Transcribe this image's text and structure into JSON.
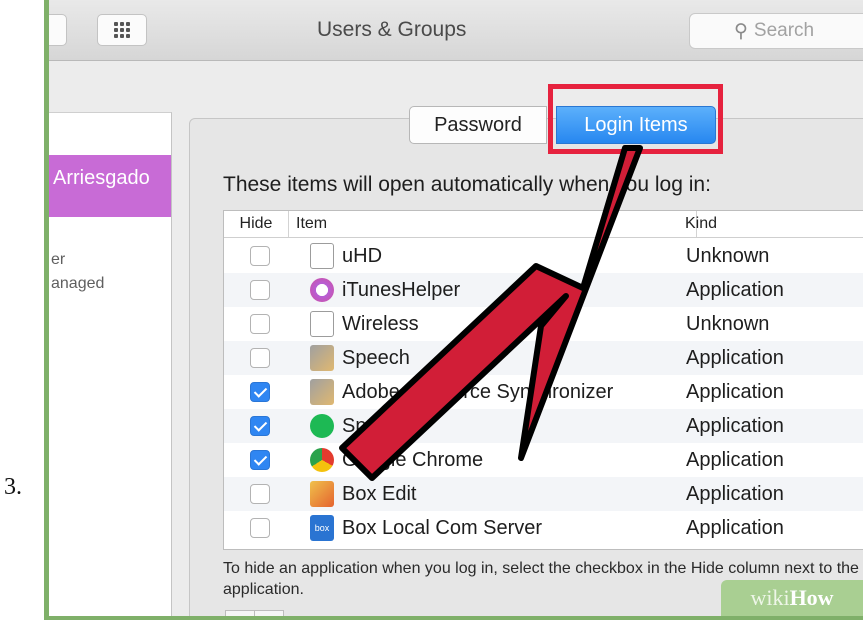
{
  "step_label": "3.",
  "window": {
    "title": "Users & Groups",
    "search_placeholder": "Search"
  },
  "users": {
    "selected": "Arriesgado",
    "line1": "er",
    "line2": "anaged"
  },
  "tabs": {
    "password": "Password",
    "login_items": "Login Items"
  },
  "login_items": {
    "heading": "These items will open automatically when you log in:",
    "columns": {
      "hide": "Hide",
      "item": "Item",
      "kind": "Kind"
    },
    "rows": [
      {
        "hide": false,
        "name": "uHD",
        "kind": "Unknown",
        "icon": "document-icon"
      },
      {
        "hide": false,
        "name": "iTunesHelper",
        "kind": "Application",
        "icon": "itunes-icon"
      },
      {
        "hide": false,
        "name": "Wireless",
        "kind": "Unknown",
        "icon": "document-icon"
      },
      {
        "hide": false,
        "name": "Speech",
        "kind": "Application",
        "icon": "utility-icon"
      },
      {
        "hide": true,
        "name": "Adobe Resource Synchronizer",
        "kind": "Application",
        "icon": "utility-icon"
      },
      {
        "hide": true,
        "name": "Spotify",
        "kind": "Application",
        "icon": "spotify-icon"
      },
      {
        "hide": true,
        "name": "Google Chrome",
        "kind": "Application",
        "icon": "chrome-icon"
      },
      {
        "hide": false,
        "name": "Box Edit",
        "kind": "Application",
        "icon": "box-edit-icon"
      },
      {
        "hide": false,
        "name": "Box Local Com Server",
        "kind": "Application",
        "icon": "box-icon"
      }
    ],
    "help_text": "To hide an application when you log in, select the checkbox in the Hide column next to the application."
  },
  "watermark": {
    "wiki": "wiki",
    "how": "How"
  },
  "colors": {
    "frame": "#7fb069",
    "selected_user": "#c86bd6",
    "accent_tab": "#2787f0",
    "highlight": "#e6223e",
    "arrow": "#d11e37"
  }
}
